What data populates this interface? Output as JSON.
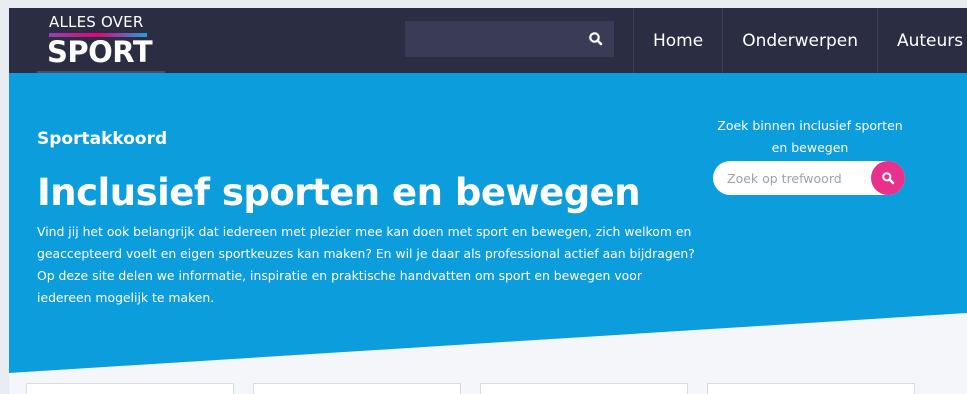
{
  "header": {
    "logo": {
      "top_text": "ALLES OVER",
      "main_text": "SPORT"
    },
    "search": {
      "placeholder": "",
      "icon": "search-icon"
    },
    "nav": [
      {
        "label": "Home"
      },
      {
        "label": "Onderwerpen"
      },
      {
        "label": "Auteurs"
      }
    ]
  },
  "hero": {
    "eyebrow": "Sportakkoord",
    "title": "Inclusief sporten en bewegen",
    "intro": "Vind jij het ook belangrijk dat iedereen met plezier mee kan doen met sport en bewegen, zich welkom en geaccepteerd voelt en eigen sportkeuzes kan maken? En wil je daar als professional actief aan bijdragen? Op deze site delen we informatie, inspiratie en praktische handvatten om sport en bewegen voor iedereen mogelijk te maken.",
    "side_search": {
      "label": "Zoek binnen inclusief sporten en bewegen",
      "placeholder": "Zoek op trefwoord",
      "icon": "search-icon"
    }
  },
  "colors": {
    "header_bg": "#2b2d42",
    "hero_bg": "#0c9ddd",
    "accent_pink": "#e8318a"
  }
}
